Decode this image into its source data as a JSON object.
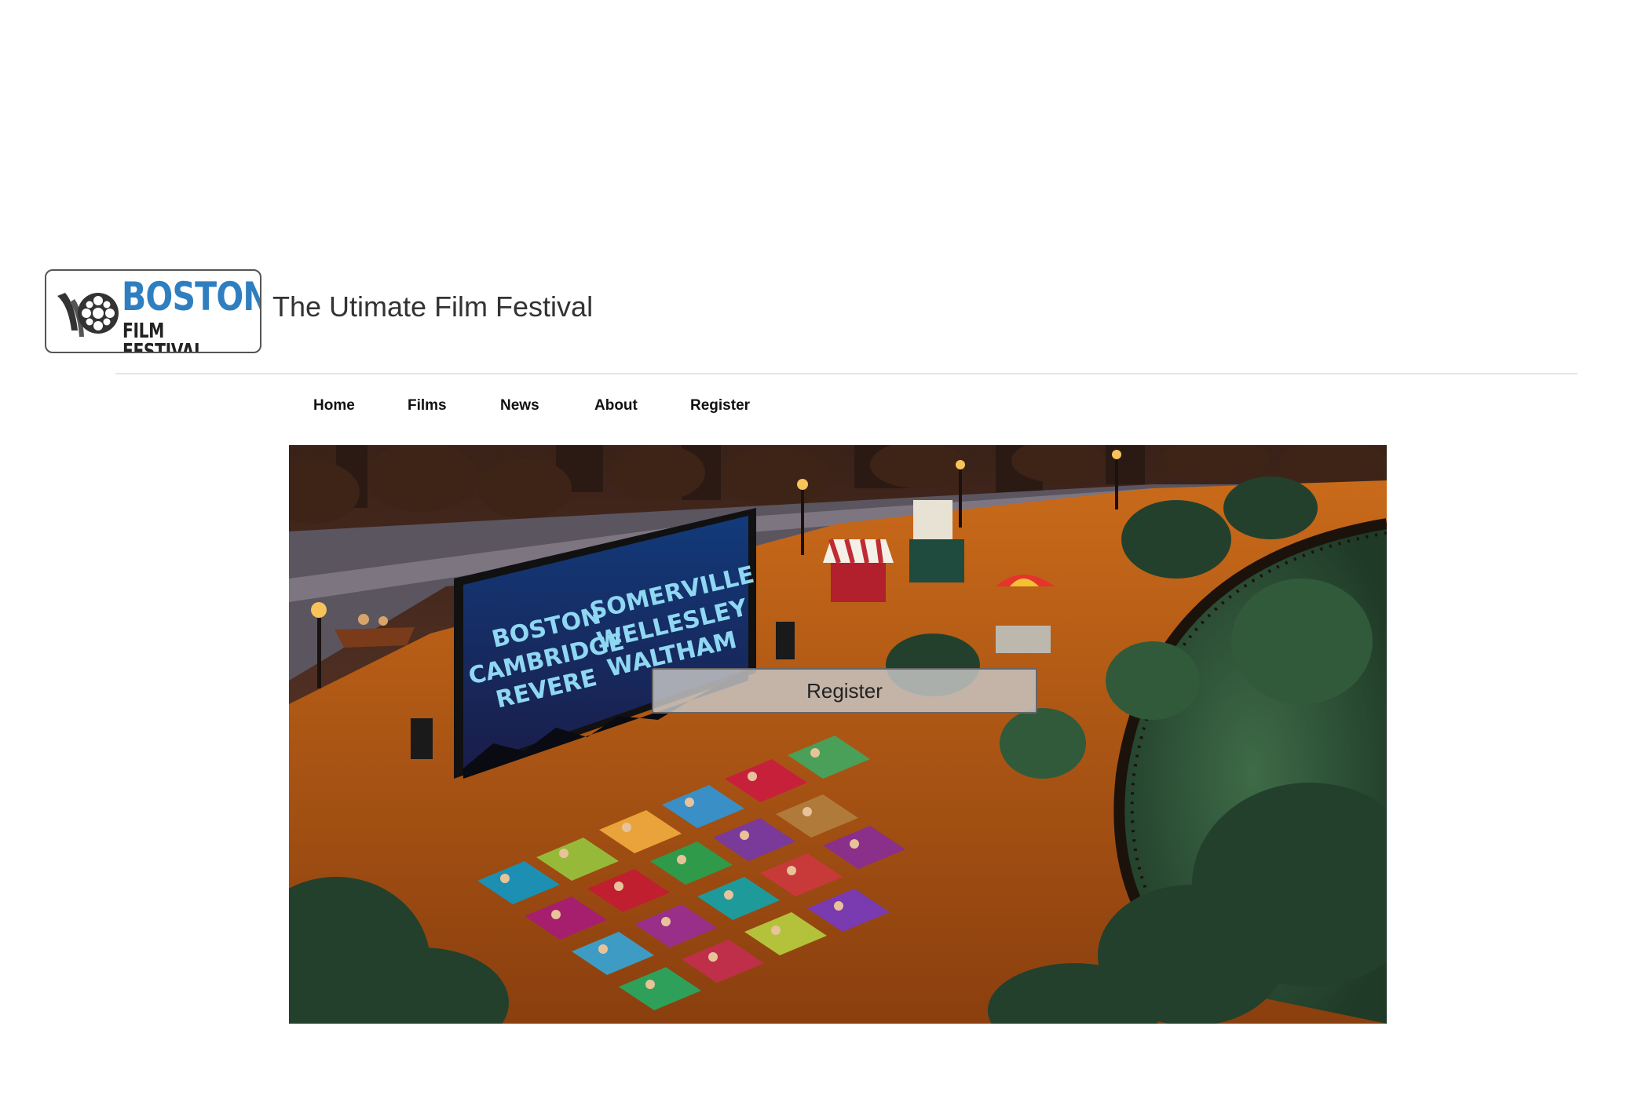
{
  "header": {
    "logo": {
      "title": "BOSTON",
      "subtitle": "FILM FESTIVAL"
    },
    "tagline": "The Utimate Film Festival"
  },
  "nav": {
    "items": [
      {
        "label": "Home"
      },
      {
        "label": "Films"
      },
      {
        "label": "News"
      },
      {
        "label": "About"
      },
      {
        "label": "Register"
      }
    ]
  },
  "hero": {
    "screen_left": [
      "BOSTON",
      "CAMBRIDGE",
      "REVERE"
    ],
    "screen_right": [
      "SOMERVILLE",
      "WELLESLEY",
      "WALTHAM"
    ],
    "register_button": "Register"
  },
  "colors": {
    "logo_blue": "#2f7fc0",
    "screen_text": "#8fd7f2",
    "ground": "#b4530f",
    "sky": "#4a2a1c"
  }
}
